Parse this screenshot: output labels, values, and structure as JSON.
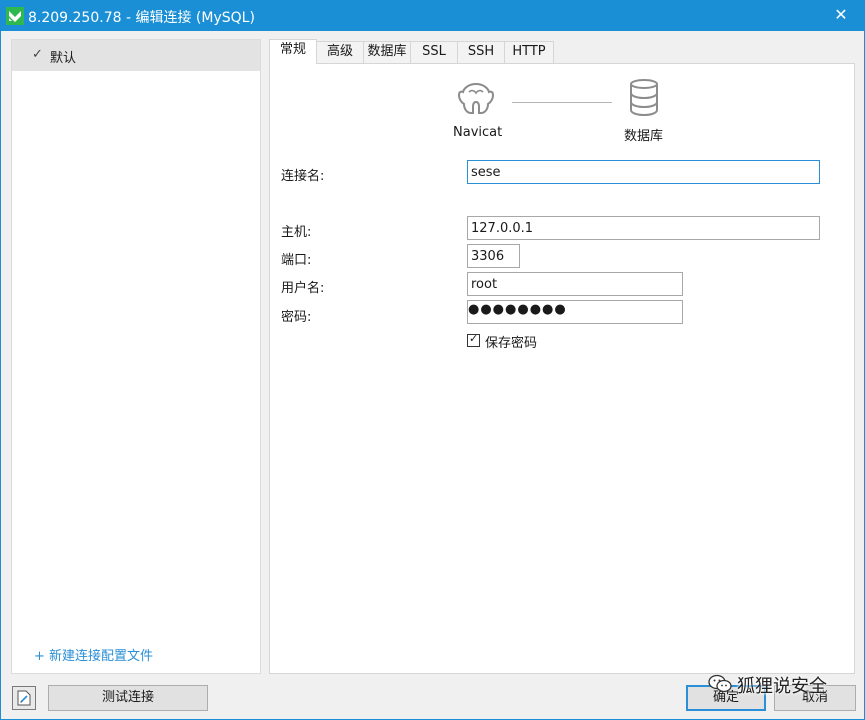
{
  "window": {
    "title": "8.209.250.78 - 编辑连接 (MySQL)",
    "close_symbol": "✕"
  },
  "profiles": {
    "items": [
      {
        "label": "默认",
        "selected": true
      }
    ],
    "check_symbol": "✓",
    "new_profile_label": "+ 新建连接配置文件"
  },
  "tabs": [
    {
      "label": "常规",
      "active": true
    },
    {
      "label": "高级"
    },
    {
      "label": "数据库"
    },
    {
      "label": "SSL"
    },
    {
      "label": "SSH"
    },
    {
      "label": "HTTP"
    }
  ],
  "graphic": {
    "left_label": "Navicat",
    "right_label": "数据库",
    "left_icon": "navicat-icon",
    "right_icon": "database-icon"
  },
  "form": {
    "connection_name": {
      "label": "连接名:",
      "value": "sese"
    },
    "host": {
      "label": "主机:",
      "value": "127.0.0.1"
    },
    "port": {
      "label": "端口:",
      "value": "3306"
    },
    "username": {
      "label": "用户名:",
      "value": "root"
    },
    "password": {
      "label": "密码:",
      "value": "●●●●●●●●"
    },
    "save_password": {
      "label": "保存密码",
      "checked": true,
      "check_symbol": "✓"
    }
  },
  "buttons": {
    "test_connection": "测试连接",
    "ok": "确定",
    "cancel": "取消"
  },
  "watermark": {
    "text": "狐狸说安全"
  },
  "colors": {
    "titlebar": "#1a8fd6",
    "accent": "#2a8fd6",
    "app_icon": "#2eb84f"
  }
}
